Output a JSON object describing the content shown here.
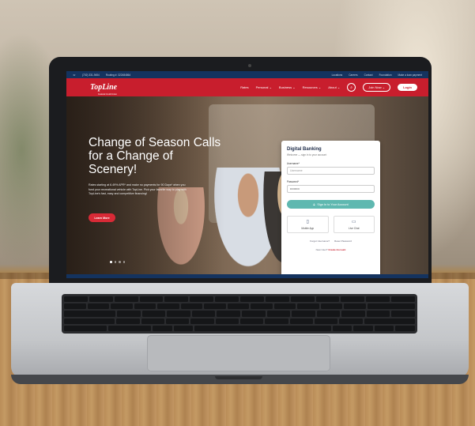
{
  "topbar": {
    "phone": "(702) 331-9454",
    "routing": "Routing #: 322484864",
    "links": [
      "Locations",
      "Careers",
      "Contact",
      "Foundation",
      "Make a loan payment"
    ]
  },
  "header": {
    "logo": "TopLine",
    "logo_sub": "Federal Credit Union",
    "nav": [
      "Rates",
      "Personal",
      "Business",
      "Resources",
      "About"
    ],
    "join_label": "Join Now",
    "login_label": "Login"
  },
  "hero": {
    "title": "Change of Season Calls for a Change of Scenery!",
    "text": "Rates starting at 6.49% APR* and make no payments for 90 Days* when you fund your recreational vehicle with TopLine. Pick your favorite way to play with TopLine's fast, easy and competitive financing!",
    "button": "Learn More"
  },
  "login": {
    "title": "Digital Banking",
    "subtitle": "Welcome — sign in to your account",
    "username_label": "Username*",
    "username_placeholder": "Username",
    "password_label": "Password*",
    "password_value": "••••••••••",
    "signin_label": "Sign In to Your Account",
    "tiles": [
      "Mobile App",
      "Live Chat"
    ],
    "forgot_username": "Forgot Username?",
    "reset_password": "Reset Password",
    "new_user": "New User?",
    "create_account": "Create Account"
  },
  "colors": {
    "brand_red": "#c81e2d",
    "navy": "#14335f",
    "teal": "#5fb8b0"
  },
  "icons": [
    "search-icon",
    "phone-icon",
    "lock-icon",
    "mobile-icon",
    "chat-icon",
    "chevron-down-icon"
  ]
}
